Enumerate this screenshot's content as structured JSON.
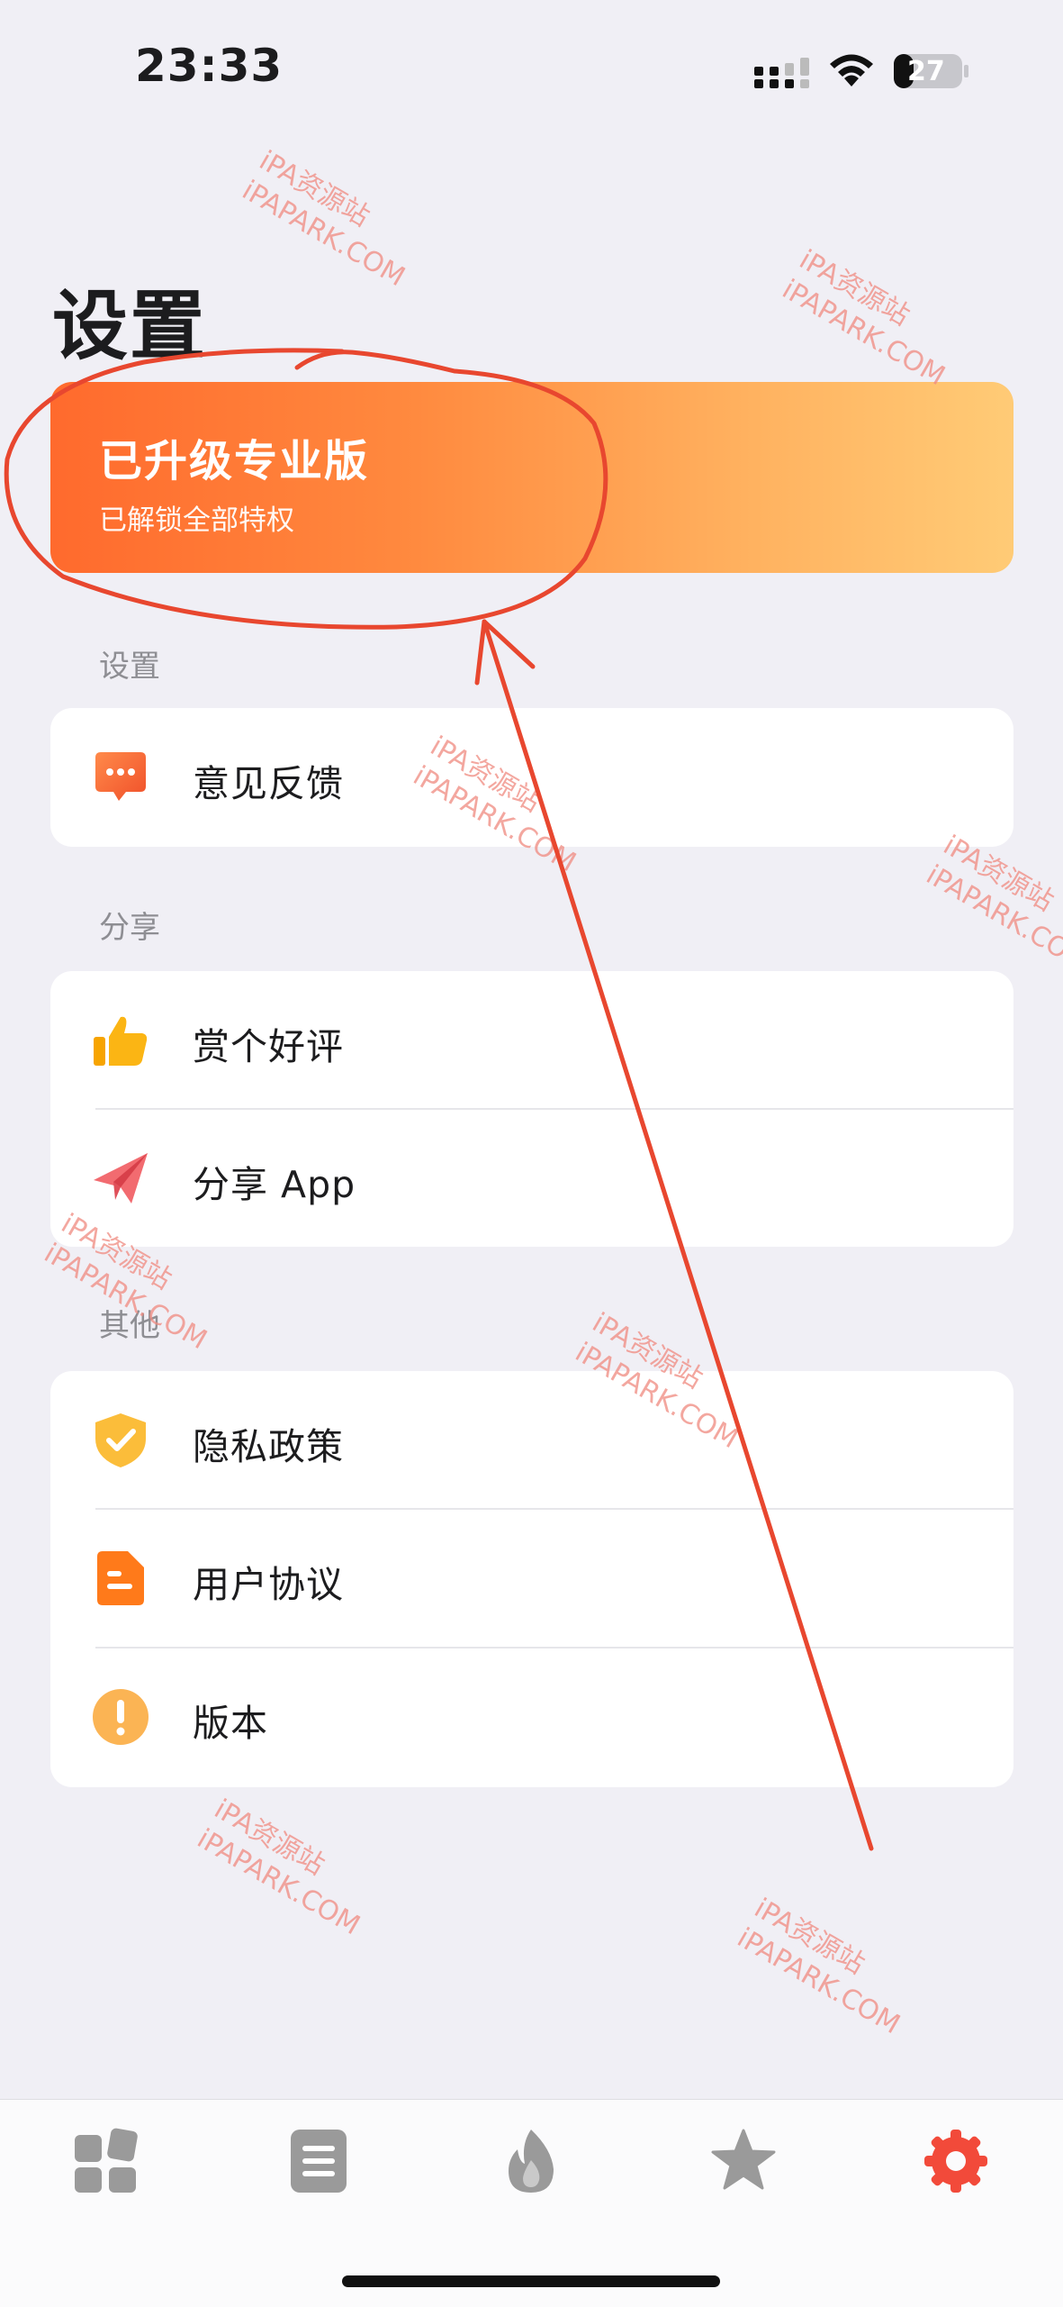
{
  "status_bar": {
    "time": "23:33",
    "battery": "27"
  },
  "page": {
    "title": "设置"
  },
  "pro": {
    "title": "已升级专业版",
    "subtitle": "已解锁全部特权"
  },
  "sections": {
    "settings": {
      "label": "设置",
      "items": [
        {
          "label": "意见反馈",
          "icon": "feedback-chat-icon"
        }
      ]
    },
    "share": {
      "label": "分享",
      "items": [
        {
          "label": "赏个好评",
          "icon": "thumbs-up-icon"
        },
        {
          "label": "分享 App",
          "icon": "paper-plane-icon"
        }
      ]
    },
    "other": {
      "label": "其他",
      "items": [
        {
          "label": "隐私政策",
          "icon": "shield-check-icon"
        },
        {
          "label": "用户协议",
          "icon": "document-icon"
        },
        {
          "label": "版本",
          "icon": "info-exclamation-icon"
        }
      ]
    }
  },
  "tabbar": {
    "tabs": [
      {
        "icon": "widgets-icon",
        "active": false
      },
      {
        "icon": "list-document-icon",
        "active": false
      },
      {
        "icon": "flame-icon",
        "active": false
      },
      {
        "icon": "star-icon",
        "active": false
      },
      {
        "icon": "gear-icon",
        "active": true
      }
    ]
  },
  "watermark": {
    "line1": "iPA资源站",
    "line2": "iPAPARK.COM"
  },
  "colors": {
    "accent": "#ff6a2d",
    "active_tab": "#f24a3a",
    "inactive_tab": "#9a9a9a",
    "annotation": "#e8472f"
  }
}
